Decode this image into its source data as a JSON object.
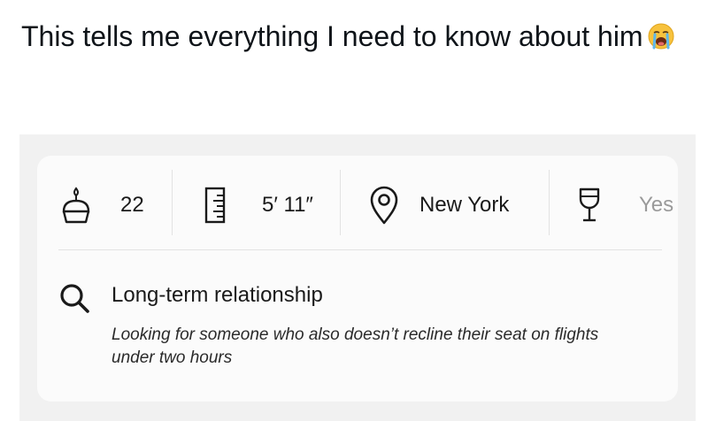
{
  "tweet": {
    "text": "This tells me everything I need to know about him",
    "emoji": "loudly-crying-face"
  },
  "profile": {
    "stats": [
      {
        "icon": "birthday-cake-icon",
        "value": "22"
      },
      {
        "icon": "ruler-icon",
        "value": "5′ 11″"
      },
      {
        "icon": "location-pin-icon",
        "value": "New York"
      },
      {
        "icon": "wine-glass-icon",
        "value": "Yes"
      }
    ],
    "intent": {
      "icon": "search-icon",
      "title": "Long-term relationship",
      "description": "Looking for someone who also doesn’t recline their seat on flights under two hours"
    }
  },
  "colors": {
    "background": "#f1f1f1",
    "card": "#fbfbfb",
    "text": "#1a1a1a"
  }
}
